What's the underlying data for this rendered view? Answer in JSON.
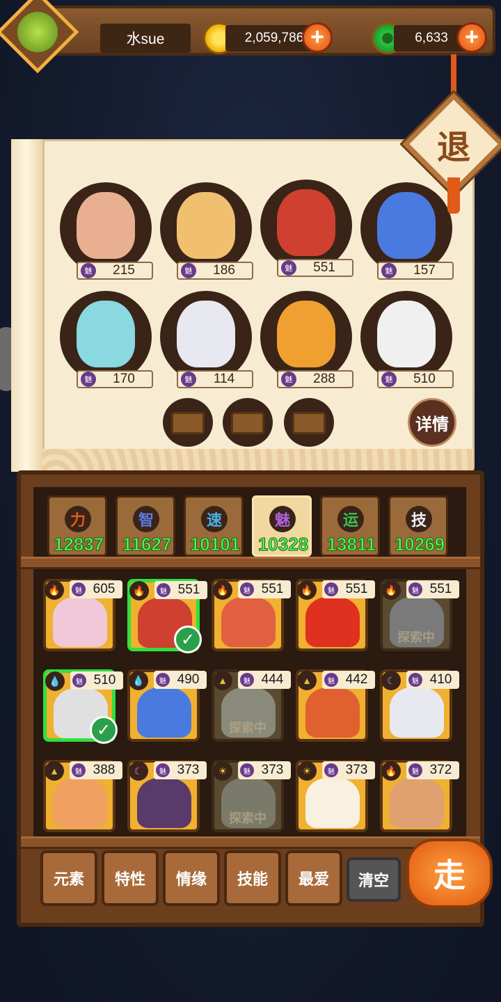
{
  "header": {
    "username": "水sue",
    "gold": "2,059,786",
    "jade": "6,633",
    "plus_label": "+"
  },
  "exit_label": "退",
  "detail_label": "详情",
  "charm_icon": "魅",
  "team": [
    {
      "value": "215",
      "color": "#e8b090"
    },
    {
      "value": "186",
      "color": "#f0c070"
    },
    {
      "value": "551",
      "color": "#d04030"
    },
    {
      "value": "157",
      "color": "#4a7ae0"
    },
    {
      "value": "170",
      "color": "#8ad8e0"
    },
    {
      "value": "114",
      "color": "#e8e8f0"
    },
    {
      "value": "288",
      "color": "#f0a030"
    },
    {
      "value": "510",
      "color": "#f0f0f0"
    }
  ],
  "stats": [
    {
      "glyph": "力",
      "value": "12837",
      "active": false,
      "icon_color": "#e05a1a"
    },
    {
      "glyph": "智",
      "value": "11627",
      "active": false,
      "icon_color": "#5a7ae0"
    },
    {
      "glyph": "速",
      "value": "10101",
      "active": false,
      "icon_color": "#4ab0e0"
    },
    {
      "glyph": "魅",
      "value": "10328",
      "active": true,
      "icon_color": "#b060e0"
    },
    {
      "glyph": "运",
      "value": "13811",
      "active": false,
      "icon_color": "#3ac050"
    },
    {
      "glyph": "技",
      "value": "10269",
      "active": false,
      "icon_color": "#f0f0f0"
    }
  ],
  "roster": [
    {
      "value": "605",
      "art": "#f0c8d8",
      "el": "fire"
    },
    {
      "value": "551",
      "art": "#d04030",
      "el": "fire",
      "selected": true
    },
    {
      "value": "551",
      "art": "#e06040",
      "el": "fire"
    },
    {
      "value": "551",
      "art": "#e03020",
      "el": "fire"
    },
    {
      "value": "551",
      "art": "#7a7a7a",
      "el": "fire",
      "exploring": true
    },
    {
      "value": "510",
      "art": "#e0e0e0",
      "el": "water",
      "selected": true
    },
    {
      "value": "490",
      "art": "#4a7ae0",
      "el": "water"
    },
    {
      "value": "444",
      "art": "#8a8a7a",
      "el": "earth",
      "exploring": true
    },
    {
      "value": "442",
      "art": "#e06030",
      "el": "earth"
    },
    {
      "value": "410",
      "art": "#e8e8f0",
      "el": "moon"
    },
    {
      "value": "388",
      "art": "#f0a060",
      "el": "earth"
    },
    {
      "value": "373",
      "art": "#5a3a6a",
      "el": "moon"
    },
    {
      "value": "373",
      "art": "#7a7a6a",
      "el": "sun",
      "exploring": true
    },
    {
      "value": "373",
      "art": "#f8f0e0",
      "el": "sun"
    },
    {
      "value": "372",
      "art": "#e0a070",
      "el": "fire"
    }
  ],
  "exploring_label": "探索中",
  "filters": [
    "元素",
    "特性",
    "情缘",
    "技能",
    "最爱"
  ],
  "clear_label": "清空",
  "go_label": "走"
}
